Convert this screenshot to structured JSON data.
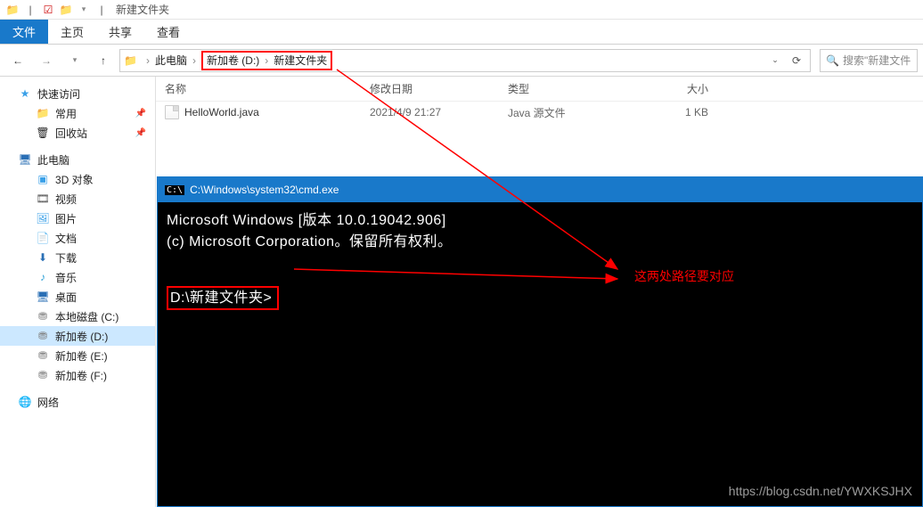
{
  "window": {
    "title": "新建文件夹"
  },
  "ribbon": {
    "file": "文件",
    "home": "主页",
    "share": "共享",
    "view": "查看"
  },
  "breadcrumb": {
    "pc": "此电脑",
    "drive": "新加卷 (D:)",
    "folder": "新建文件夹"
  },
  "search": {
    "placeholder": "搜索\"新建文件"
  },
  "sidebar": {
    "quick_access": "快速访问",
    "common": "常用",
    "recycle": "回收站",
    "this_pc": "此电脑",
    "threed": "3D 对象",
    "videos": "视频",
    "pictures": "图片",
    "documents": "文档",
    "downloads": "下载",
    "music": "音乐",
    "desktop": "桌面",
    "drive_c": "本地磁盘 (C:)",
    "drive_d": "新加卷 (D:)",
    "drive_e": "新加卷 (E:)",
    "drive_f": "新加卷 (F:)",
    "network": "网络"
  },
  "columns": {
    "name": "名称",
    "date": "修改日期",
    "type": "类型",
    "size": "大小"
  },
  "files": [
    {
      "name": "HelloWorld.java",
      "date": "2021/4/9 21:27",
      "type": "Java 源文件",
      "size": "1 KB"
    }
  ],
  "cmd": {
    "title": "C:\\Windows\\system32\\cmd.exe",
    "line1": "Microsoft Windows [版本 10.0.19042.906]",
    "line2": "(c) Microsoft Corporation。保留所有权利。",
    "prompt": "D:\\新建文件夹>"
  },
  "annotation": {
    "text": "这两处路径要对应"
  },
  "watermark": "https://blog.csdn.net/YWXKSJHX"
}
